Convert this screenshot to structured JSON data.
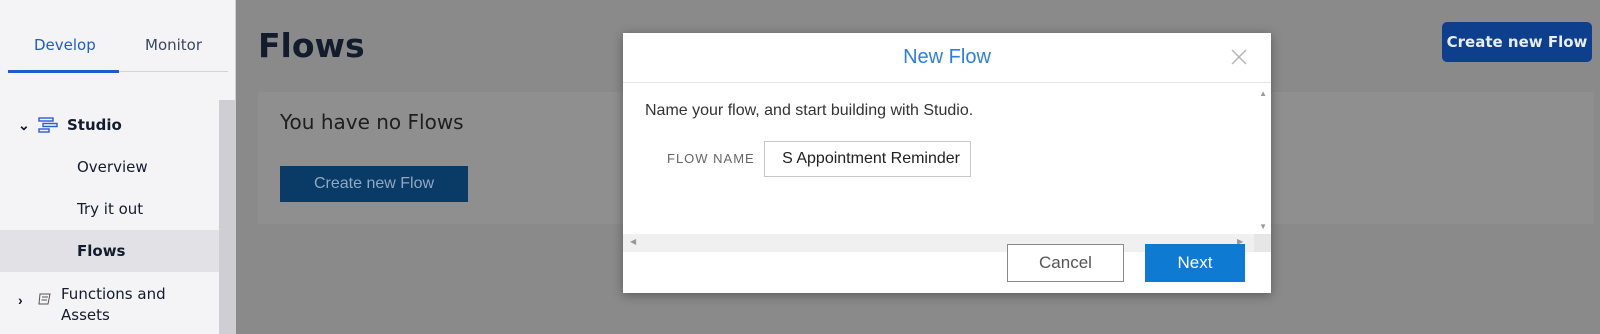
{
  "sidebar": {
    "tabs": [
      {
        "label": "Develop",
        "active": true
      },
      {
        "label": "Monitor",
        "active": false
      }
    ],
    "items": [
      {
        "label": "Studio",
        "icon": "studio-icon",
        "expanded": true
      },
      {
        "label": "Overview"
      },
      {
        "label": "Try it out"
      },
      {
        "label": "Flows",
        "selected": true
      },
      {
        "label": "Functions and Assets",
        "icon": "functions-icon",
        "expanded": false
      }
    ]
  },
  "main": {
    "title": "Flows",
    "create_button": "Create new Flow",
    "empty_message": "You have no Flows",
    "empty_create_button": "Create new Flow"
  },
  "modal": {
    "title": "New Flow",
    "intro": "Name your flow, and start building with Studio.",
    "field_label": "FLOW NAME",
    "field_value": "S Appointment Reminder",
    "cancel_label": "Cancel",
    "next_label": "Next"
  },
  "colors": {
    "accent": "#1f5cc7",
    "modal_title": "#2e7fd9",
    "primary_button": "#0f7ad1",
    "top_button": "#0d3f8c",
    "overlay": "#8a8a8a"
  }
}
